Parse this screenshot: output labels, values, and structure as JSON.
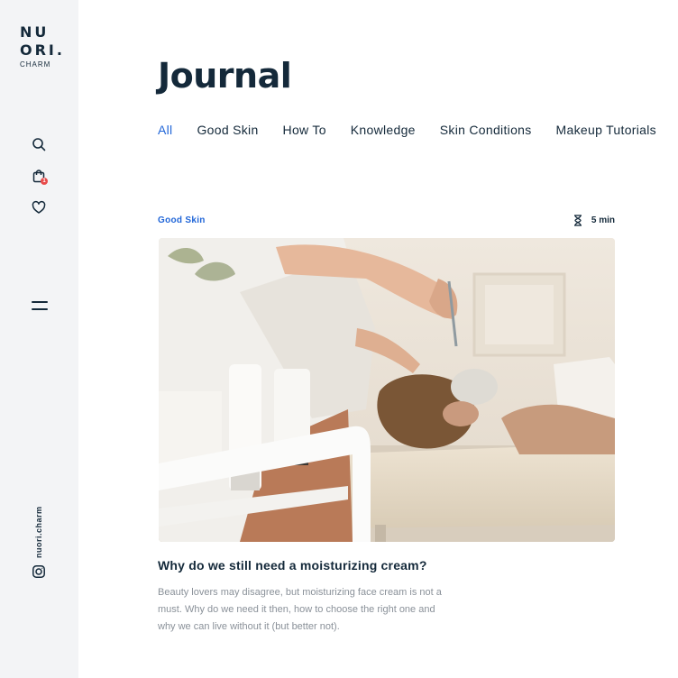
{
  "brand": {
    "logo_line1": "NU",
    "logo_line2": "ORI.",
    "logo_sub": "CHARM"
  },
  "sidebar": {
    "icons": [
      "search-icon",
      "shopping-bag-icon",
      "heart-icon",
      "menu-icon",
      "instagram-icon"
    ],
    "cart_count": "1",
    "social_handle": "nuori.charm"
  },
  "page": {
    "title": "Journal"
  },
  "tabs": [
    {
      "label": "All",
      "active": true
    },
    {
      "label": "Good Skin",
      "active": false
    },
    {
      "label": "How To",
      "active": false
    },
    {
      "label": "Knowledge",
      "active": false
    },
    {
      "label": "Skin Conditions",
      "active": false
    },
    {
      "label": "Makeup Tutorials",
      "active": false
    }
  ],
  "article": {
    "category": "Good Skin",
    "read_time": "5 min",
    "title": "Why do we still need a moisturizing cream?",
    "excerpt": "Beauty lovers may disagree, but moisturizing face cream is not a must. Why do we need it then, how to choose the right one and why we can live without it (but better not)."
  },
  "colors": {
    "accent": "#2166d8",
    "text": "#14293a",
    "muted": "#8a9199",
    "sidebar_bg": "#f3f4f6",
    "badge": "#e84a4a"
  }
}
